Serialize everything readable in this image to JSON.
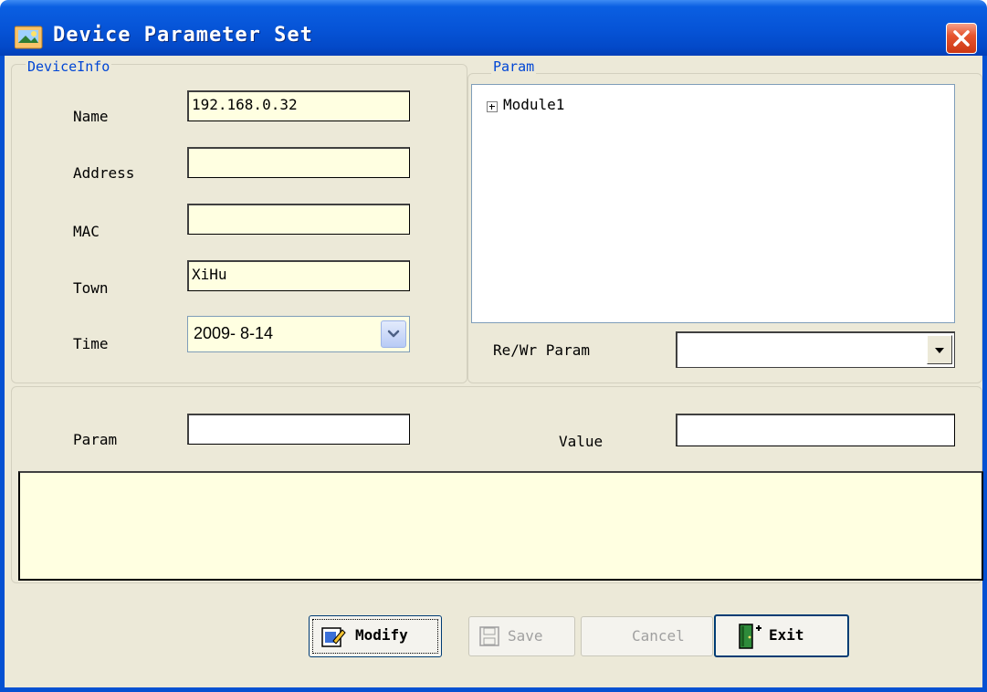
{
  "window": {
    "title": "Device Parameter Set"
  },
  "device_info": {
    "group_label": "DeviceInfo",
    "fields": [
      {
        "label": "Name",
        "value": "192.168.0.32"
      },
      {
        "label": "Address",
        "value": ""
      },
      {
        "label": "MAC",
        "value": ""
      },
      {
        "label": "Town",
        "value": "XiHu"
      }
    ],
    "time": {
      "label": "Time",
      "value": "2009- 8-14"
    }
  },
  "param_tree": {
    "group_label": "Param",
    "items": [
      {
        "label": "Module1",
        "expander": "+"
      }
    ]
  },
  "rewr": {
    "label": "Re/Wr Param",
    "value": ""
  },
  "edit": {
    "param_label": "Param",
    "param_value": "",
    "value_label": "Value",
    "value_value": ""
  },
  "memo": {
    "text": ""
  },
  "buttons": {
    "modify": "Modify",
    "save": "Save",
    "cancel": "Cancel",
    "exit": "Exit"
  },
  "colors": {
    "titlebar": "#0653d6",
    "client": "#ece9d8",
    "field_yellow": "#ffffe1",
    "group_label": "#0046d5",
    "close": "#e6542e"
  },
  "icons": [
    "app-icon",
    "close-icon",
    "expand-plus-icon",
    "chevron-down-icon",
    "dropdown-arrow-icon",
    "modify-icon",
    "save-icon",
    "exit-door-icon"
  ]
}
